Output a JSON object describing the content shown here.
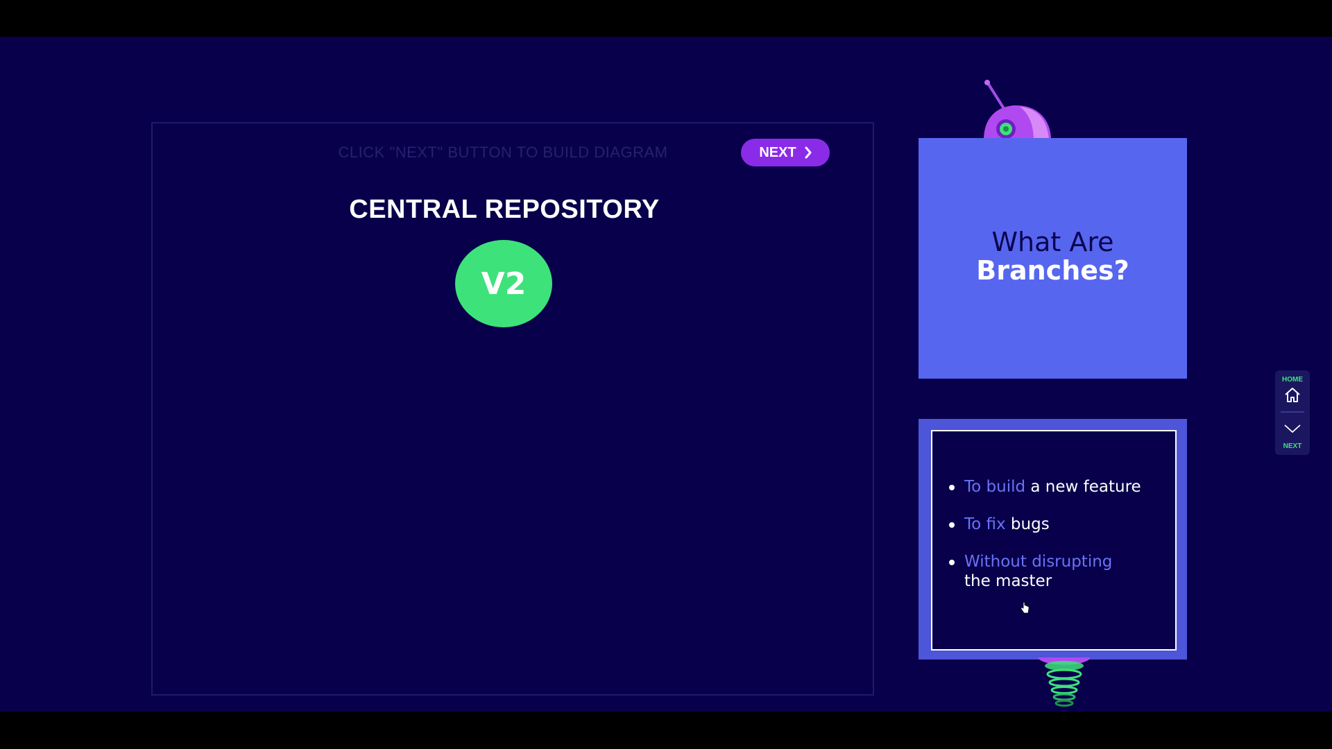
{
  "diagram": {
    "instruction": "CLICK \"NEXT\" BUTTON TO BUILD DIAGRAM",
    "next_button_label": "NEXT",
    "repo_title": "CENTRAL REPOSITORY",
    "version_label": "V2"
  },
  "title_card": {
    "line1": "What Are",
    "line2": "Branches?"
  },
  "bullets": [
    {
      "accent": "To build",
      "rest": " a new feature"
    },
    {
      "accent": "To fix",
      "rest": " bugs"
    },
    {
      "accent": "Without disrupting",
      "rest": "the master"
    }
  ],
  "side_nav": {
    "home_label": "HOME",
    "next_label": "NEXT"
  },
  "colors": {
    "background": "#08004a",
    "accent_purple": "#8a2be8",
    "node_green": "#3ee27a",
    "card_blue": "#5766ef",
    "bullet_accent": "#6a72f5"
  },
  "icons": [
    "chevron-right-icon",
    "home-icon",
    "chevron-down-icon",
    "robot-head-icon",
    "robot-spring-icon",
    "hand-cursor-icon"
  ]
}
